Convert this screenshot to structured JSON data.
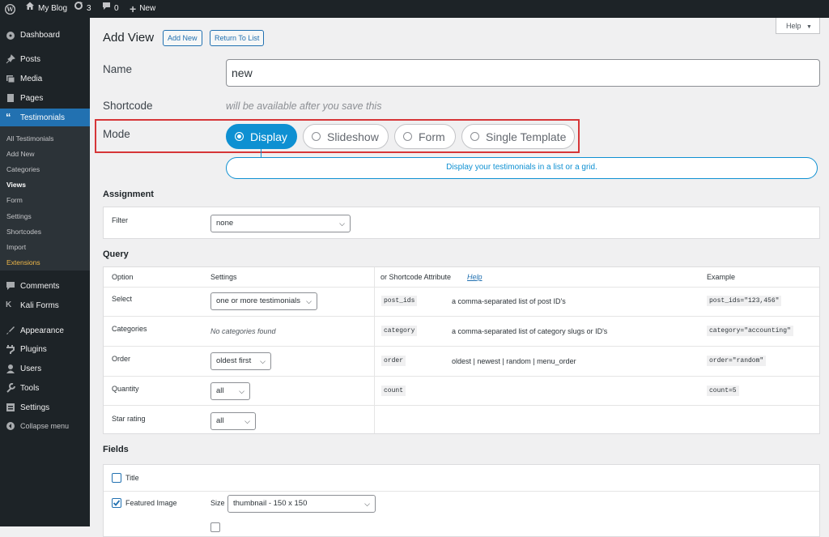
{
  "adminbar": {
    "site": "My Blog",
    "updates": "3",
    "comments": "0",
    "new": "New"
  },
  "menu": {
    "dashboard": "Dashboard",
    "posts": "Posts",
    "media": "Media",
    "pages": "Pages",
    "testimonials": "Testimonials",
    "sub": [
      "All Testimonials",
      "Add New",
      "Categories",
      "Views",
      "Form",
      "Settings",
      "Shortcodes",
      "Import",
      "Extensions"
    ],
    "comments": "Comments",
    "kali": "Kali Forms",
    "appearance": "Appearance",
    "plugins": "Plugins",
    "users": "Users",
    "tools": "Tools",
    "settings": "Settings",
    "collapse": "Collapse menu"
  },
  "header": {
    "title": "Add View",
    "add_new": "Add New",
    "return": "Return To List",
    "help": "Help"
  },
  "form": {
    "name_label": "Name",
    "name_value": "new",
    "shortcode_label": "Shortcode",
    "shortcode_note": "will be available after you save this",
    "mode_label": "Mode",
    "modes": [
      "Display",
      "Slideshow",
      "Form",
      "Single Template"
    ],
    "mode_desc": "Display your testimonials in a list or a grid."
  },
  "assignment": {
    "title": "Assignment",
    "filter_label": "Filter",
    "filter_value": "none"
  },
  "query": {
    "title": "Query",
    "headers": {
      "option": "Option",
      "settings": "Settings",
      "attr": "or Shortcode Attribute",
      "help": "Help",
      "example": "Example"
    },
    "rows": [
      {
        "option": "Select",
        "setting": "one or more testimonials",
        "code": "post_ids",
        "desc": "a comma-separated list of post ID's",
        "example": "post_ids=\"123,456\""
      },
      {
        "option": "Categories",
        "setting": "No categories found",
        "code": "category",
        "desc": "a comma-separated list of category slugs or ID's",
        "example": "category=\"accounting\""
      },
      {
        "option": "Order",
        "setting": "oldest first",
        "code": "order",
        "desc": "oldest | newest | random | menu_order",
        "example": "order=\"random\""
      },
      {
        "option": "Quantity",
        "setting": "all",
        "code": "count",
        "desc": "",
        "example": "count=5"
      },
      {
        "option": "Star rating",
        "setting": "all",
        "code": "",
        "desc": "",
        "example": ""
      }
    ]
  },
  "fields": {
    "title": "Fields",
    "title_field": "Title",
    "featured": "Featured Image",
    "size_label": "Size",
    "size_value": "thumbnail - 150 x 150"
  },
  "colors": {
    "accent": "#2271b1",
    "active": "#0e90d2",
    "highlight": "#d63638"
  }
}
